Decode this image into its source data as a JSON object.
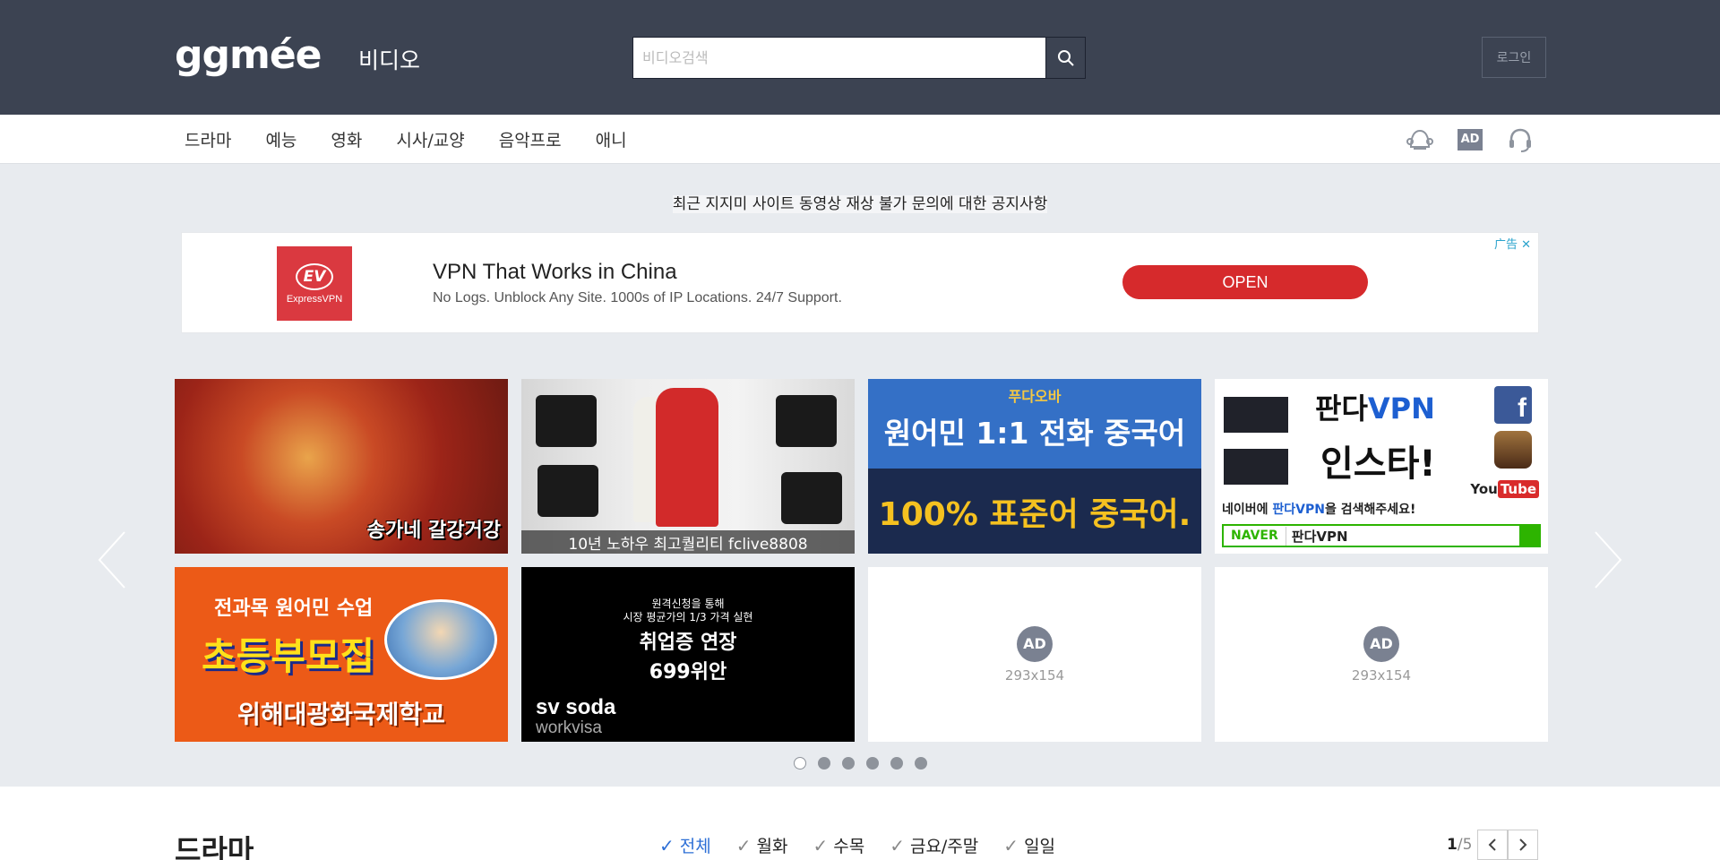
{
  "header": {
    "logo": "ggmée",
    "section": "비디오",
    "search_placeholder": "비디오검색",
    "login": "로그인"
  },
  "nav": {
    "items": [
      {
        "label": "드라마"
      },
      {
        "label": "예능"
      },
      {
        "label": "영화"
      },
      {
        "label": "시사/교양"
      },
      {
        "label": "음악프로"
      },
      {
        "label": "애니"
      }
    ],
    "icons": [
      "notification-icon",
      "ad-icon",
      "headset-icon"
    ],
    "ad_icon_label": "AD"
  },
  "notice": "최근 지지미 사이트 동영상 재상 불가 문의에 대한 공지사항",
  "ad_banner": {
    "logo_text": "ExpressVPN",
    "logo_mark": "EV",
    "headline": "VPN That Works in China",
    "subtext": "No Logs. Unblock Any Site. 1000s of IP Locations. 24/7 Support.",
    "button": "OPEN",
    "choice": "广告 ✕",
    "brand_color": "#da3940",
    "button_color": "#d62a2c"
  },
  "carousel": {
    "tile1": {
      "caption": "송가네 갈강거강"
    },
    "tile2": {
      "caption": "10년 노하우 최고퀄리티 fclive8808"
    },
    "tile3": {
      "crown": "푸다오바",
      "line1": "원어민 1:1 전화 중국어",
      "line2": "100% 표준어 중국어."
    },
    "tile4": {
      "title_a": "판다",
      "title_b": "VPN",
      "line2": "인스타!",
      "mid_a": "네이버에 ",
      "mid_b": "판다VPN",
      "mid_c": "을 검색해주세요!",
      "naver": "NAVER",
      "query": "판다VPN",
      "youtube_a": "You",
      "youtube_b": "Tube",
      "facebook": "f"
    },
    "tile5": {
      "line1": "전과목 원어민 수업",
      "line2": "초등부모집",
      "line3": "위해대광화국제학교"
    },
    "tile6": {
      "line1": "원격신청을 통해",
      "line2": "시장 평균가의 1/3 가격 실현",
      "line3": "취업증 연장",
      "line4": "699위안",
      "brand_a": "sv soda",
      "brand_b": "workvisa"
    },
    "placeholder": {
      "badge": "AD",
      "size": "293x154"
    },
    "dots": 6,
    "active_dot": 0
  },
  "drama": {
    "title": "드라마",
    "filters": [
      {
        "label": "전체",
        "active": true
      },
      {
        "label": "월화",
        "active": false
      },
      {
        "label": "수목",
        "active": false
      },
      {
        "label": "금요/주말",
        "active": false
      },
      {
        "label": "일일",
        "active": false
      }
    ],
    "page_current": "1",
    "page_total": "/5"
  },
  "colors": {
    "header_bg": "#3c4352",
    "page_bg": "#e8ebef",
    "active_filter": "#2d6fd6"
  }
}
